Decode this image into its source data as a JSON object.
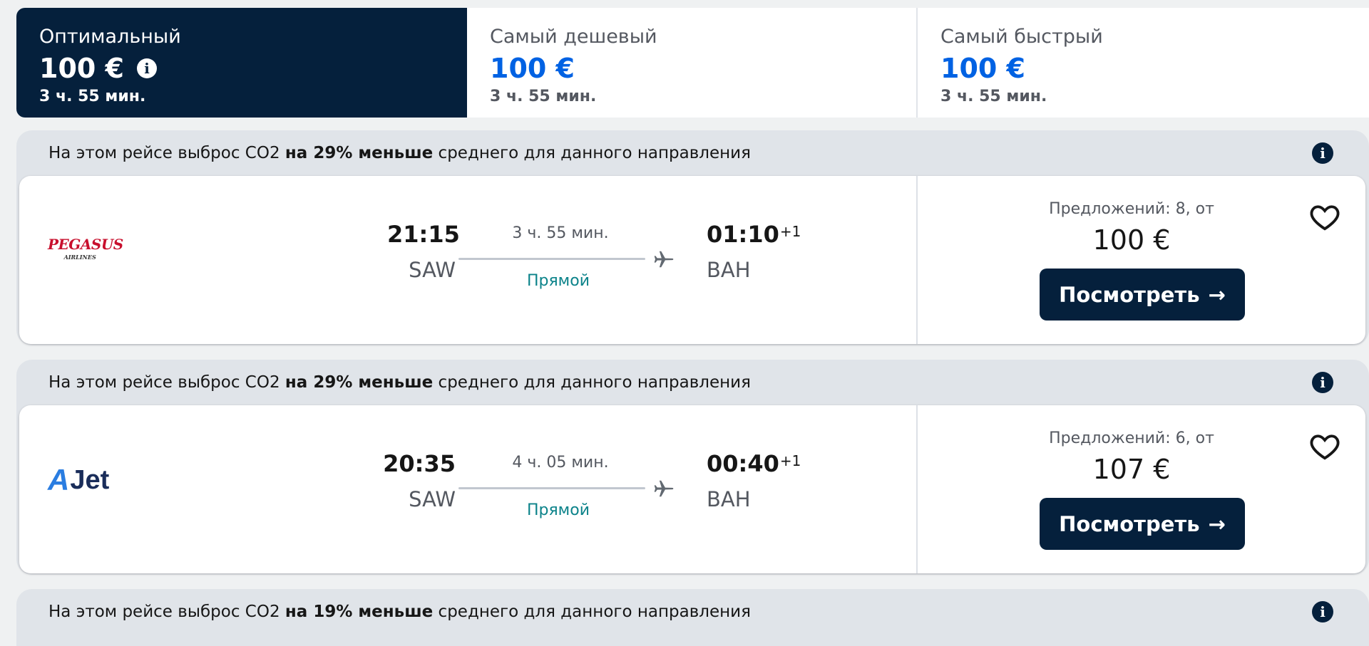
{
  "sort_tabs": [
    {
      "label": "Оптимальный",
      "price": "100 €",
      "duration": "3 ч. 55 мин.",
      "selected": true
    },
    {
      "label": "Самый дешевый",
      "price": "100 €",
      "duration": "3 ч. 55 мин.",
      "selected": false
    },
    {
      "label": "Самый быстрый",
      "price": "100 €",
      "duration": "3 ч. 55 мин.",
      "selected": false
    }
  ],
  "colors": {
    "navy": "#05203c",
    "price_blue": "#0062e3",
    "direct_teal": "#0c838a",
    "group_bg": "#e0e4e9",
    "page_bg": "#eff1f2"
  },
  "flights": [
    {
      "eco": {
        "prefix": "На этом рейсе выброс CO2 ",
        "bold": "на 29% меньше",
        "suffix": " среднего для данного направления"
      },
      "airline": {
        "name": "PEGASUS",
        "sub": "AIRLINES",
        "logo_icon": "pegasus-logo"
      },
      "depart_time": "21:15",
      "depart_code": "SAW",
      "duration": "3 ч. 55 мин.",
      "stops": "Прямой",
      "arrive_time": "01:10",
      "arrive_day_offset": "+1",
      "arrive_code": "BAH",
      "offers": "Предложений: 8, от",
      "price": "100 €",
      "button": "Посмотреть",
      "button_arrow": "→"
    },
    {
      "eco": {
        "prefix": "На этом рейсе выброс CO2 ",
        "bold": "на 29% меньше",
        "suffix": " среднего для данного направления"
      },
      "airline": {
        "name_a": "A",
        "name_rest": "Jet",
        "logo_icon": "ajet-logo"
      },
      "depart_time": "20:35",
      "depart_code": "SAW",
      "duration": "4 ч. 05 мин.",
      "stops": "Прямой",
      "arrive_time": "00:40",
      "arrive_day_offset": "+1",
      "arrive_code": "BAH",
      "offers": "Предложений: 6, от",
      "price": "107 €",
      "button": "Посмотреть",
      "button_arrow": "→"
    }
  ],
  "partial_flight": {
    "eco": {
      "prefix": "На этом рейсе выброс CO2 ",
      "bold": "на 19% меньше",
      "suffix": " среднего для данного направления"
    }
  },
  "info_glyph": "i"
}
